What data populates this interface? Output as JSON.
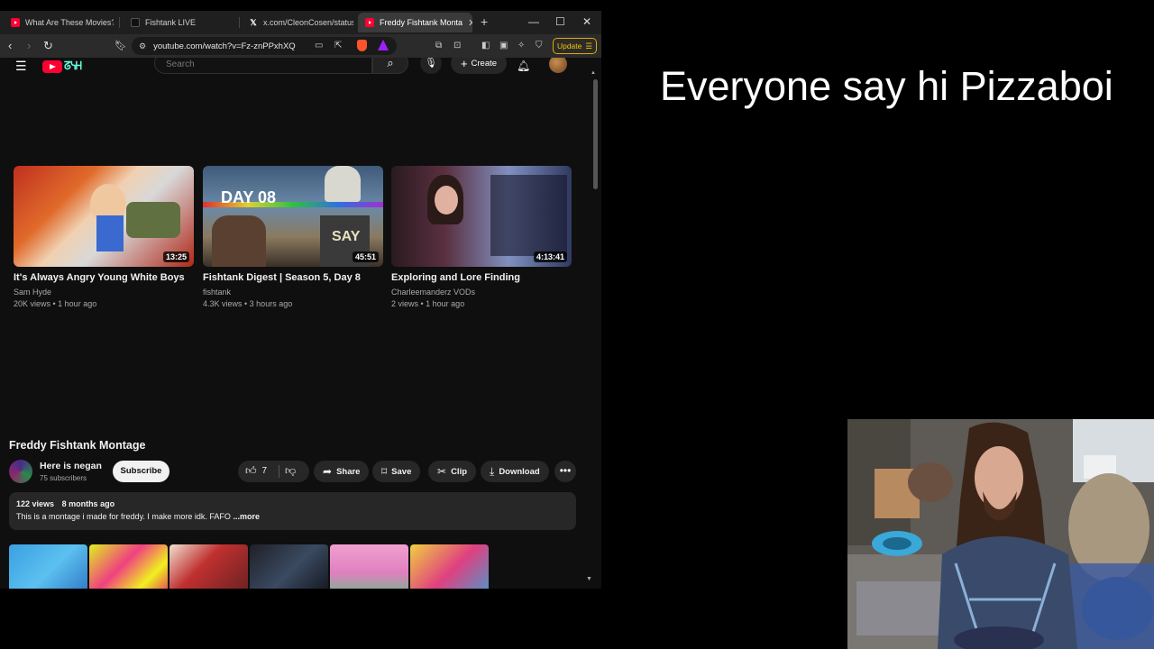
{
  "browser": {
    "tabs": [
      {
        "title": "What Are These Movies?!? /",
        "favicon": "youtube-icon"
      },
      {
        "title": "Fishtank LIVE",
        "favicon": "fishtank-icon"
      },
      {
        "title": "x.com/CleonCosen/status/1",
        "favicon": "x-icon"
      },
      {
        "title": "Freddy Fishtank Monta",
        "favicon": "youtube-icon",
        "active": true
      }
    ],
    "url": "youtube.com/watch?v=Fz-znPPxhXQ",
    "update_label": "Update"
  },
  "youtube": {
    "search_placeholder": "Search",
    "create_label": "Create",
    "recommended": [
      {
        "title": "It's Always Angry Young White Boys",
        "channel": "Sam Hyde",
        "meta": "20K views • 1 hour ago",
        "duration": "13:25"
      },
      {
        "title": "Fishtank Digest | Season 5, Day 8",
        "channel": "fishtank",
        "meta": "4.3K views • 3 hours ago",
        "duration": "45:51",
        "thumb_text": "DAY 08",
        "thumb_text2": "SAY"
      },
      {
        "title": "Exploring and Lore Finding",
        "channel": "Charleemanderz VODs",
        "meta": "2 views • 1 hour ago",
        "duration": "4:13:41"
      }
    ],
    "watch": {
      "title": "Freddy Fishtank Montage",
      "channel_name": "Here is negan",
      "subscribers": "75 subscribers",
      "subscribe_label": "Subscribe",
      "like_count": "7",
      "share_label": "Share",
      "save_label": "Save",
      "clip_label": "Clip",
      "download_label": "Download",
      "views": "122 views",
      "date": "8 months ago",
      "description": "This is a montage i made for freddy. I make more idk. FAFO",
      "more_label": "...more"
    }
  },
  "overlay": {
    "text": "Everyone say hi Pizzaboi"
  },
  "colors": {
    "youtube_red": "#ff0033",
    "update_yellow": "#f5c400"
  }
}
